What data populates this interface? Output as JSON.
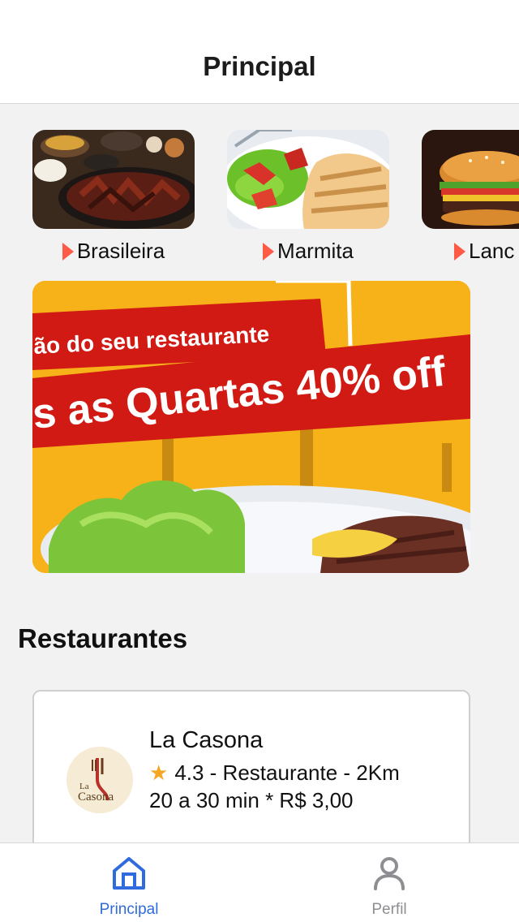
{
  "header": {
    "title": "Principal"
  },
  "categories": [
    {
      "label": "Brasileira",
      "image": "feijoada-photo"
    },
    {
      "label": "Marmita",
      "image": "grilled-chicken-salad-photo"
    },
    {
      "label": "Lanc",
      "image": "burger-photo"
    }
  ],
  "banner": {
    "line1": "ão do seu restaurante",
    "line2": "s as Quartas 40% off"
  },
  "restaurants_section": {
    "title": "Restaurantes"
  },
  "restaurants": [
    {
      "name": "La Casona",
      "rating": "4.3",
      "details": "4.3 - Restaurante - 2Km",
      "delivery": "20 a 30 min * R$ 3,00",
      "logo_text_1": "La",
      "logo_text_2": "Casona"
    }
  ],
  "tabbar": {
    "tabs": [
      {
        "label": "Principal",
        "icon": "home-icon",
        "active": true
      },
      {
        "label": "Perfil",
        "icon": "user-icon",
        "active": false
      }
    ]
  },
  "colors": {
    "accent": "#2f6bdc",
    "category_arrow": "#ff5a45",
    "star": "#f5a623",
    "banner_red": "#d11a14",
    "banner_yellow": "#f7b21a"
  }
}
